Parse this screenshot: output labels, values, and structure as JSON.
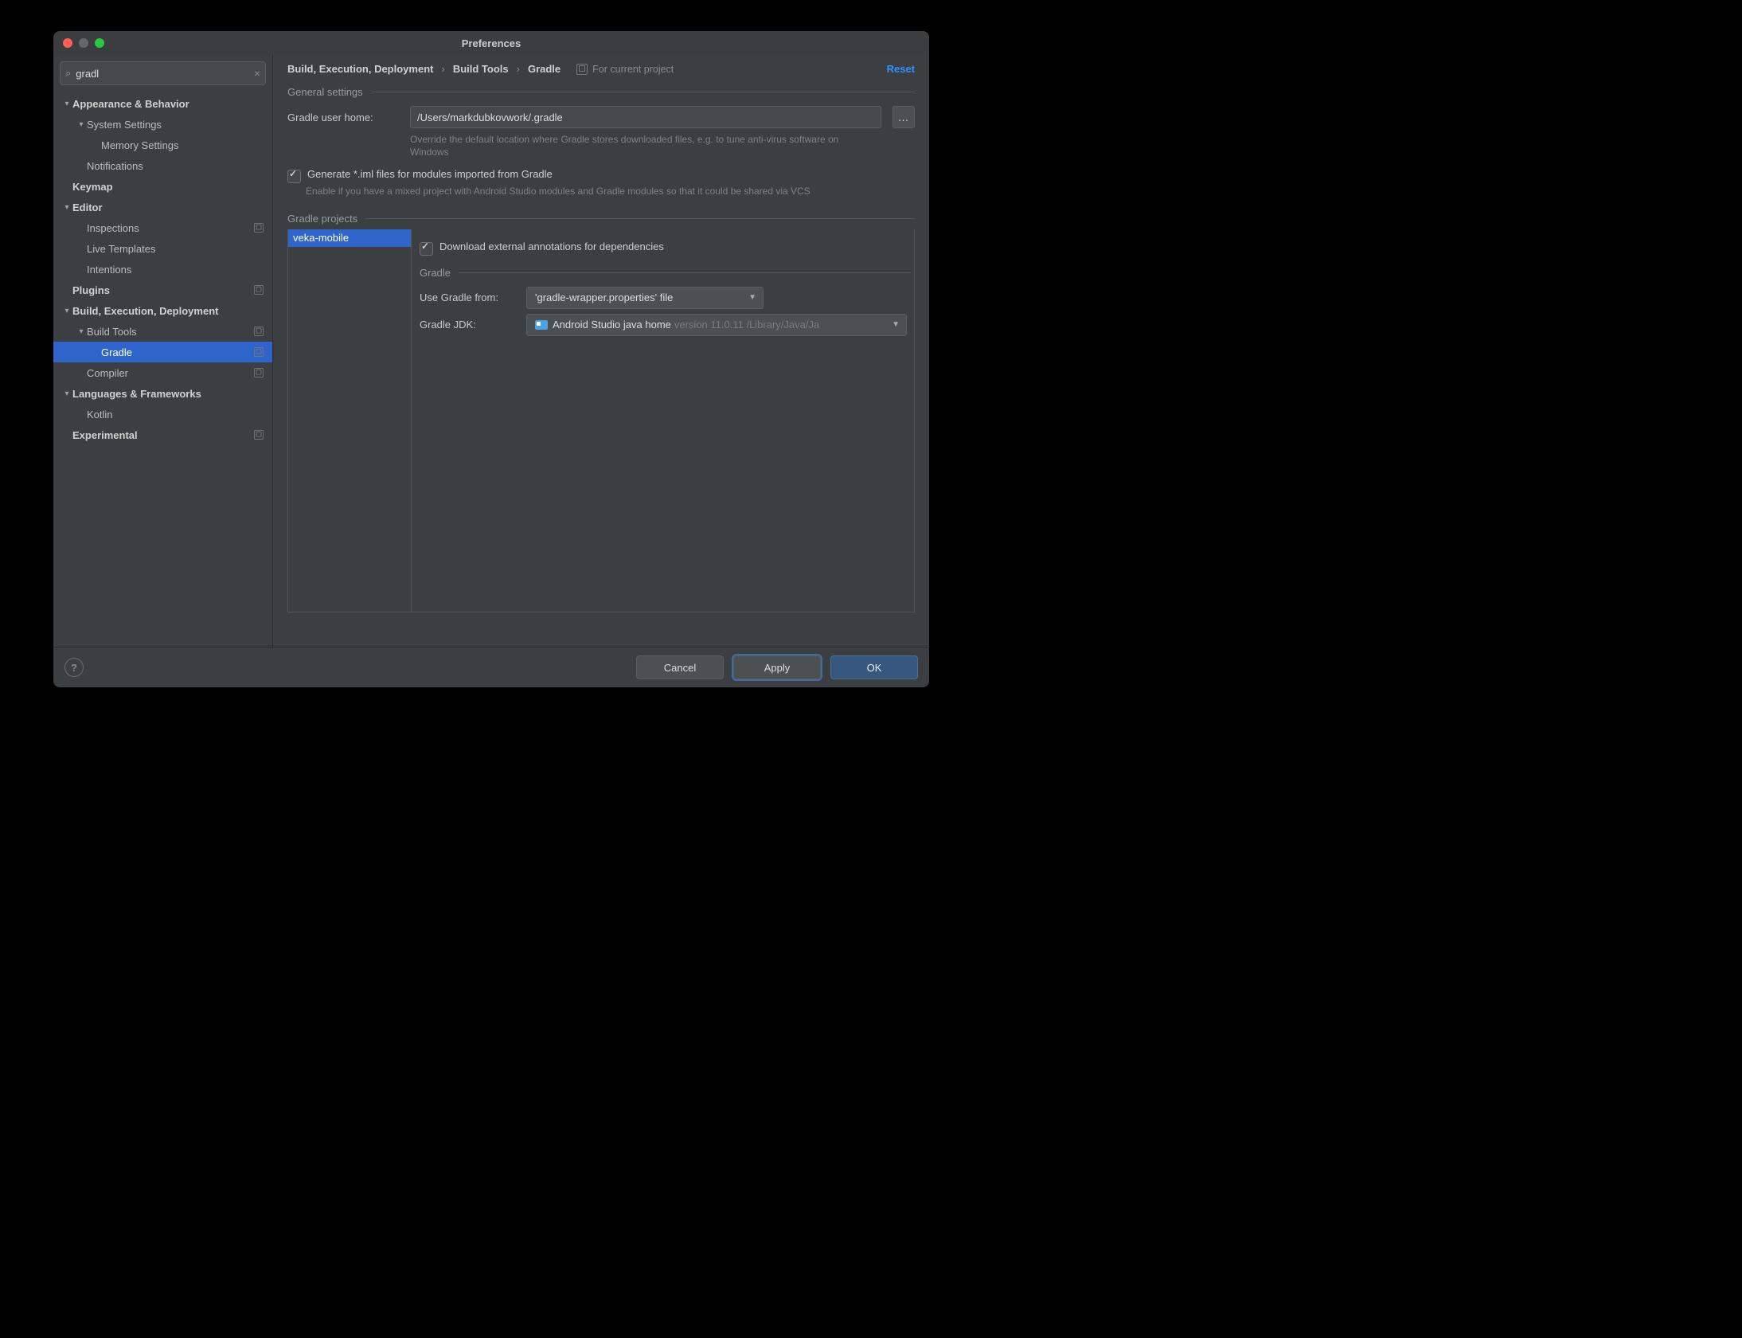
{
  "window": {
    "title": "Preferences"
  },
  "search": {
    "value": "gradl"
  },
  "sidebar": {
    "items": [
      {
        "label": "Appearance & Behavior",
        "bold": true,
        "chev": "▾",
        "indent": 0,
        "badge": false
      },
      {
        "label": "System Settings",
        "bold": false,
        "chev": "▾",
        "indent": 1,
        "badge": false
      },
      {
        "label": "Memory Settings",
        "bold": false,
        "chev": "",
        "indent": 2,
        "badge": false
      },
      {
        "label": "Notifications",
        "bold": false,
        "chev": "",
        "indent": 1,
        "badge": false
      },
      {
        "label": "Keymap",
        "bold": true,
        "chev": "",
        "indent": 0,
        "badge": false
      },
      {
        "label": "Editor",
        "bold": true,
        "chev": "▾",
        "indent": 0,
        "badge": false
      },
      {
        "label": "Inspections",
        "bold": false,
        "chev": "",
        "indent": 1,
        "badge": true
      },
      {
        "label": "Live Templates",
        "bold": false,
        "chev": "",
        "indent": 1,
        "badge": false
      },
      {
        "label": "Intentions",
        "bold": false,
        "chev": "",
        "indent": 1,
        "badge": false
      },
      {
        "label": "Plugins",
        "bold": true,
        "chev": "",
        "indent": 0,
        "badge": true
      },
      {
        "label": "Build, Execution, Deployment",
        "bold": true,
        "chev": "▾",
        "indent": 0,
        "badge": false
      },
      {
        "label": "Build Tools",
        "bold": false,
        "chev": "▾",
        "indent": 1,
        "badge": true
      },
      {
        "label": "Gradle",
        "bold": false,
        "chev": "",
        "indent": 2,
        "badge": true,
        "selected": true
      },
      {
        "label": "Compiler",
        "bold": false,
        "chev": "",
        "indent": 1,
        "badge": true
      },
      {
        "label": "Languages & Frameworks",
        "bold": true,
        "chev": "▾",
        "indent": 0,
        "badge": false
      },
      {
        "label": "Kotlin",
        "bold": false,
        "chev": "",
        "indent": 1,
        "badge": false
      },
      {
        "label": "Experimental",
        "bold": true,
        "chev": "",
        "indent": 0,
        "badge": true
      }
    ]
  },
  "breadcrumbs": {
    "a": "Build, Execution, Deployment",
    "b": "Build Tools",
    "c": "Gradle",
    "sep": "›",
    "scope": "For current project",
    "reset": "Reset"
  },
  "general": {
    "title": "General settings",
    "home_label": "Gradle user home:",
    "home_value": "/Users/markdubkovwork/.gradle",
    "home_hint": "Override the default location where Gradle stores downloaded files, e.g. to tune anti-virus software on Windows",
    "iml_label": "Generate *.iml files for modules imported from Gradle",
    "iml_hint": "Enable if you have a mixed project with Android Studio modules and Gradle modules so that it could be shared via VCS"
  },
  "projects": {
    "title": "Gradle projects",
    "items": [
      "veka-mobile"
    ],
    "download_label": "Download external annotations for dependencies",
    "sub_title": "Gradle",
    "use_from_label": "Use Gradle from:",
    "use_from_value": "'gradle-wrapper.properties' file",
    "jdk_label": "Gradle JDK:",
    "jdk_main": "Android Studio java home",
    "jdk_sub": "version 11.0.11 /Library/Java/Ja"
  },
  "footer": {
    "cancel": "Cancel",
    "apply": "Apply",
    "ok": "OK"
  }
}
